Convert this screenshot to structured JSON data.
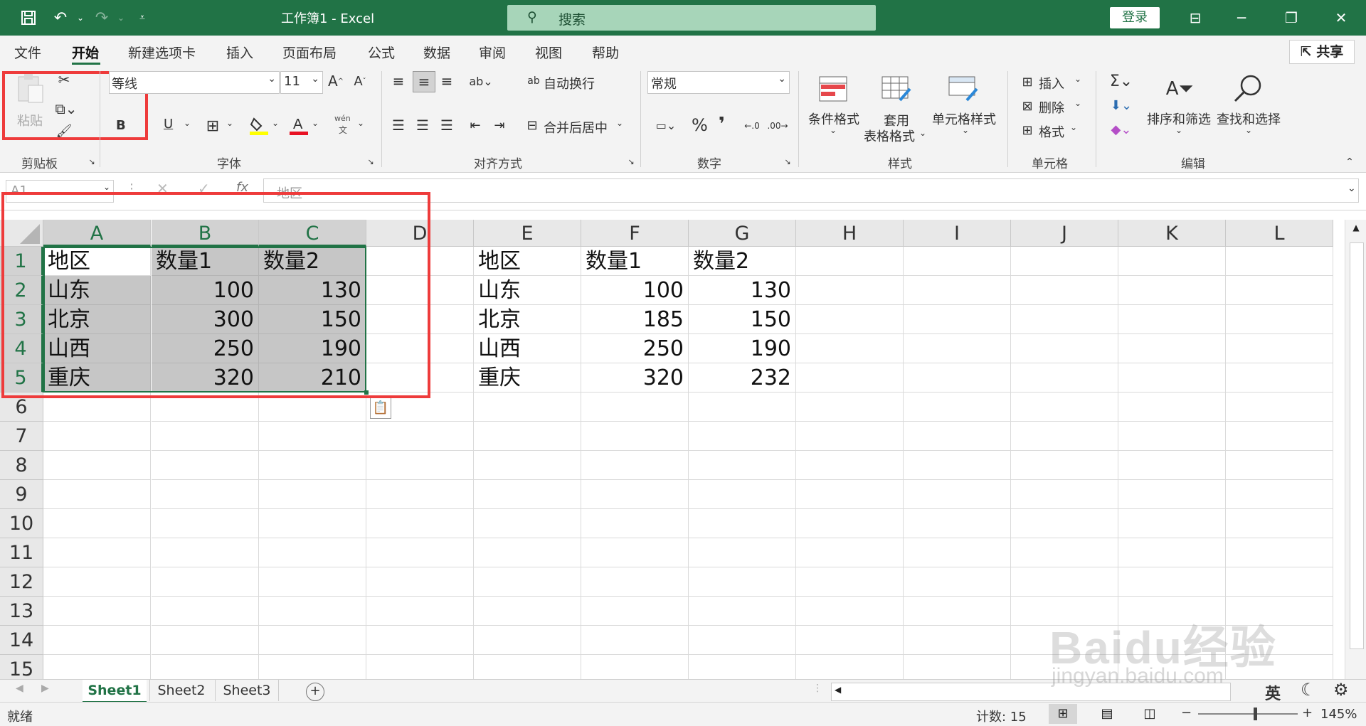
{
  "title_bar": {
    "doc_title": "工作簿1 - Excel",
    "search_placeholder": "搜索",
    "login_label": "登录",
    "quick_access": [
      "save-icon",
      "undo-icon",
      "redo-icon",
      "customize-icon"
    ],
    "window_buttons": [
      "ribbon-display-icon",
      "minimize-icon",
      "restore-icon",
      "close-icon"
    ]
  },
  "menu": {
    "tabs": [
      "文件",
      "开始",
      "新建选项卡",
      "插入",
      "页面布局",
      "公式",
      "数据",
      "审阅",
      "视图",
      "帮助"
    ],
    "active_tab": "开始",
    "share_label": "共享"
  },
  "ribbon": {
    "clipboard": {
      "paste_label": "粘贴",
      "group_label": "剪贴板"
    },
    "font": {
      "font_name": "等线",
      "font_size": "11",
      "bold_label": "B",
      "underline_label": "U",
      "phonetic_label": "wén",
      "phonetic_sub": "文",
      "group_label": "字体"
    },
    "alignment": {
      "wrap_label": "自动换行",
      "merge_label": "合并后居中",
      "group_label": "对齐方式"
    },
    "number": {
      "format_value": "常规",
      "percent_label": "%",
      "comma_label": "❜",
      "group_label": "数字"
    },
    "styles": {
      "conditional_label": "条件格式",
      "table_label_1": "套用",
      "table_label_2": "表格格式",
      "cell_style_label": "单元格样式",
      "group_label": "样式"
    },
    "cells": {
      "insert_label": "插入",
      "delete_label": "删除",
      "format_label": "格式",
      "group_label": "单元格"
    },
    "editing": {
      "sort_label": "排序和筛选",
      "find_label": "查找和选择",
      "group_label": "编辑"
    },
    "accent_color": "#217346",
    "highlight_color": "#ee3b3b"
  },
  "formula_bar": {
    "name_box": "A1",
    "fx_label": "fx",
    "content": "地区"
  },
  "sheet": {
    "columns": [
      "A",
      "B",
      "C",
      "D",
      "E",
      "F",
      "G",
      "H",
      "I",
      "J",
      "K",
      "L"
    ],
    "rows": [
      "1",
      "2",
      "3",
      "4",
      "5",
      "6",
      "7",
      "8",
      "9",
      "10",
      "11",
      "12",
      "13",
      "14",
      "15"
    ],
    "cells": {
      "A1": "地区",
      "B1": "数量1",
      "C1": "数量2",
      "A2": "山东",
      "B2": "100",
      "C2": "130",
      "A3": "北京",
      "B3": "300",
      "C3": "150",
      "A4": "山西",
      "B4": "250",
      "C4": "190",
      "A5": "重庆",
      "B5": "320",
      "C5": "210",
      "E1": "地区",
      "F1": "数量1",
      "G1": "数量2",
      "E2": "山东",
      "F2": "100",
      "G2": "130",
      "E3": "北京",
      "F3": "185",
      "G3": "150",
      "E4": "山西",
      "F4": "250",
      "G4": "190",
      "E5": "重庆",
      "F5": "320",
      "G5": "232"
    },
    "selection": "A1:C5"
  },
  "sheet_tabs": {
    "tabs": [
      "Sheet1",
      "Sheet2",
      "Sheet3"
    ],
    "active": "Sheet1",
    "add_label": "+"
  },
  "status_bar": {
    "ready": "就绪",
    "count_text": "计数: 15",
    "zoom": "145%",
    "ime_label": "英"
  },
  "watermark": {
    "brand": "Baidu经验",
    "url": "jingyan.baidu.com"
  }
}
